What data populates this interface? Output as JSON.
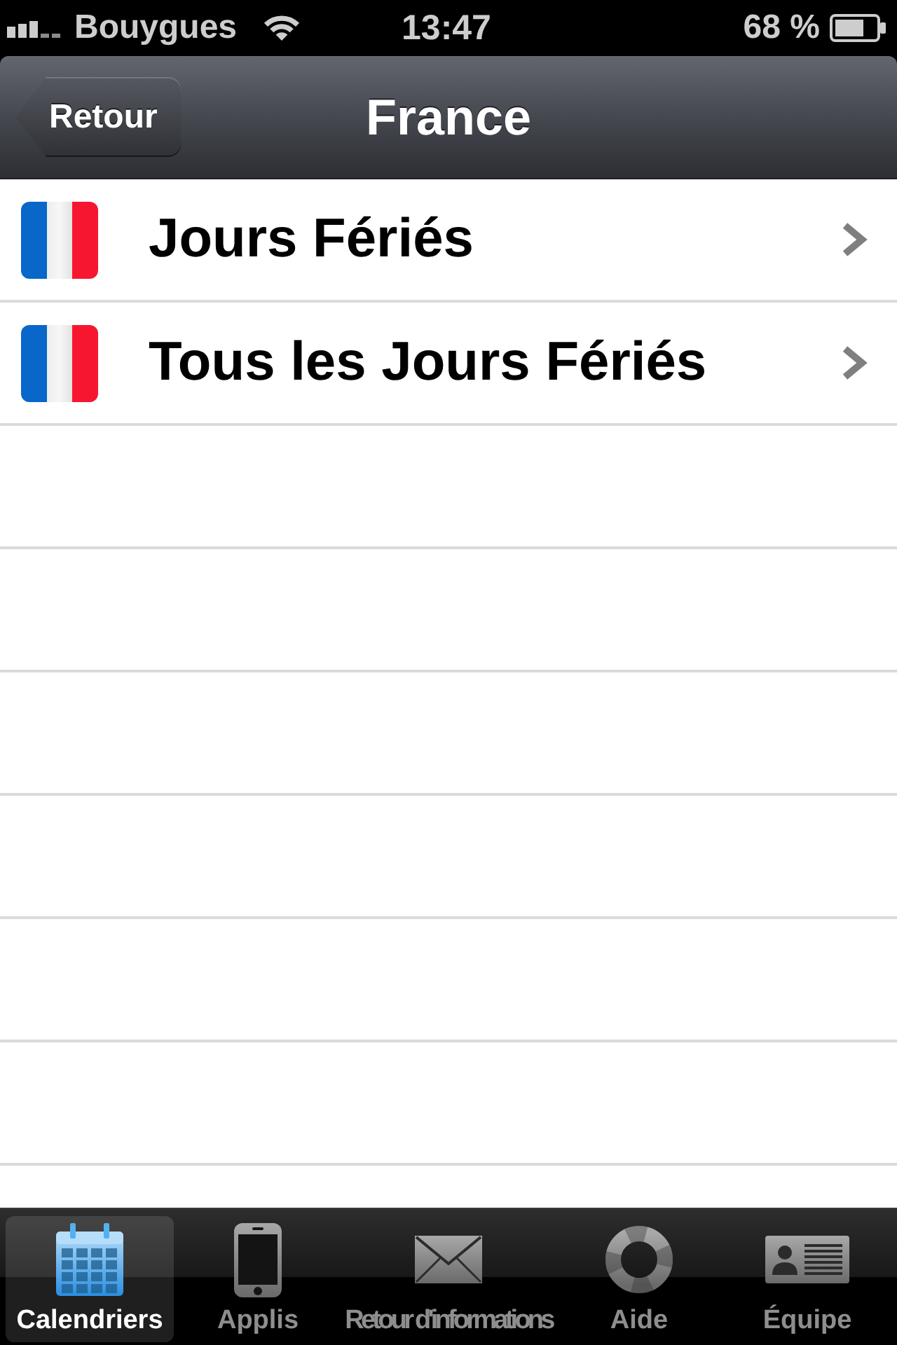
{
  "status_bar": {
    "carrier": "Bouygues",
    "time": "13:47",
    "battery": "68 %"
  },
  "nav_bar": {
    "back_button": "Retour",
    "title": "France"
  },
  "list": {
    "items": [
      {
        "label": "Jours Fériés"
      },
      {
        "label": "Tous les Jours Fériés"
      }
    ]
  },
  "tab_bar": {
    "tabs": [
      {
        "label": "Calendriers",
        "selected": true
      },
      {
        "label": "Applis",
        "selected": false
      },
      {
        "label": "Retour d'informations",
        "selected": false
      },
      {
        "label": "Aide",
        "selected": false
      },
      {
        "label": "Équipe",
        "selected": false
      }
    ]
  }
}
